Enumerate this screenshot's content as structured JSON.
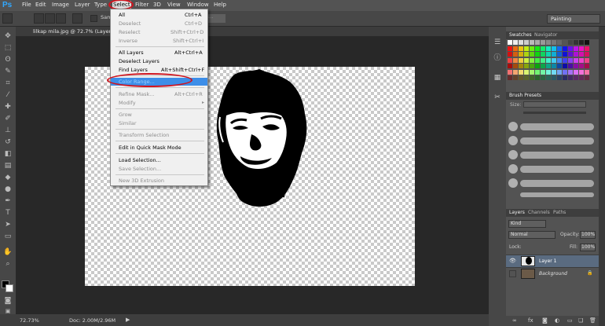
{
  "app": {
    "logo": "Ps"
  },
  "menubar": {
    "items": [
      "File",
      "Edit",
      "Image",
      "Layer",
      "Type",
      "Select",
      "Filter",
      "3D",
      "View",
      "Window",
      "Help"
    ]
  },
  "options": {
    "sample_label": "Sam",
    "field_value": "ds...",
    "workspace": "Painting"
  },
  "document": {
    "tab": "lilkap mila.jpg @ 72.7% (Layer 1, RGB/8)"
  },
  "status": {
    "zoom": "72.73%",
    "doc_size": "Doc: 2.00M/2.96M"
  },
  "select_menu": {
    "items": [
      {
        "label": "All",
        "shortcut": "Ctrl+A",
        "disabled": false
      },
      {
        "label": "Deselect",
        "shortcut": "Ctrl+D",
        "disabled": true
      },
      {
        "label": "Reselect",
        "shortcut": "Shift+Ctrl+D",
        "disabled": true
      },
      {
        "label": "Inverse",
        "shortcut": "Shift+Ctrl+I",
        "disabled": true
      },
      {
        "label": "All Layers",
        "shortcut": "Alt+Ctrl+A",
        "disabled": false
      },
      {
        "label": "Deselect Layers",
        "shortcut": "",
        "disabled": false
      },
      {
        "label": "Find Layers",
        "shortcut": "Alt+Shift+Ctrl+F",
        "disabled": false
      },
      {
        "label": "Color Range...",
        "shortcut": "",
        "disabled": false,
        "highlight": true
      },
      {
        "label": "Refine Mask...",
        "shortcut": "Alt+Ctrl+R",
        "disabled": true
      },
      {
        "label": "Modify",
        "shortcut": "",
        "disabled": true
      },
      {
        "label": "Grow",
        "shortcut": "",
        "disabled": true
      },
      {
        "label": "Similar",
        "shortcut": "",
        "disabled": true
      },
      {
        "label": "Transform Selection",
        "shortcut": "",
        "disabled": true
      },
      {
        "label": "Edit in Quick Mask Mode",
        "shortcut": "",
        "disabled": false
      },
      {
        "label": "Load Selection...",
        "shortcut": "",
        "disabled": false
      },
      {
        "label": "Save Selection...",
        "shortcut": "",
        "disabled": true
      },
      {
        "label": "New 3D Extrusion",
        "shortcut": "",
        "disabled": true
      }
    ],
    "submenu_arrow": "▸"
  },
  "panels": {
    "swatches_tabs": [
      "Swatches",
      "Navigator"
    ],
    "brush_tab": "Brush Presets",
    "brush_size_label": "Size:",
    "layers_tabs": [
      "Layers",
      "Channels",
      "Paths"
    ],
    "kind": "Kind",
    "blend_mode": "Normal",
    "opacity_label": "Opacity:",
    "opacity": "100%",
    "lock_label": "Lock:",
    "fill_label": "Fill:",
    "fill": "100%",
    "layers": [
      {
        "name": "Layer 1",
        "selected": true
      },
      {
        "name": "Background",
        "selected": false
      }
    ]
  },
  "colors": {
    "accent": "#3d8ee8",
    "annotation": "#d0151f"
  }
}
